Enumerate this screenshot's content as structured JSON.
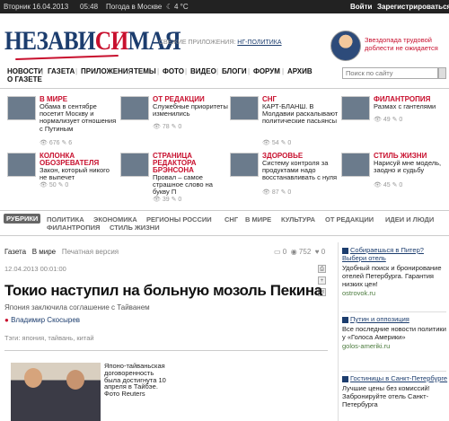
{
  "topbar": {
    "date": "Вторник 16.04.2013",
    "time": "05:48",
    "weather": "Погода в Москве",
    "temp": "4 °C",
    "login": "Войти",
    "register": "Зарегистрироваться"
  },
  "brand": {
    "logo_blue_1": "НЕЗАВИ",
    "logo_red": "СИ",
    "logo_blue_2": "МАЯ"
  },
  "fresh": {
    "label": "СВЕЖИЕ ПРИЛОЖЕНИЯ:",
    "link": "НГ-ПОЛИТИКА"
  },
  "promo": {
    "text": "Звездопада трудовой доблести не ожидается"
  },
  "nav": {
    "items": [
      "НОВОСТИ",
      "ГАЗЕТА",
      "ПРИЛОЖЕНИЯ",
      "ТЕМЫ",
      "ФОТО",
      "ВИДЕО",
      "БЛОГИ",
      "ФОРУМ",
      "АРХИВ"
    ],
    "line2": "О ГАЗЕТЕ",
    "separator": "|",
    "search_placeholder": "Поиск по сайту"
  },
  "tiles": [
    {
      "category": "В МИРЕ",
      "title": "Обама в сентябре посетит Москву и нормализует отношения с Путиным",
      "views": "676",
      "comments": "6"
    },
    {
      "category": "ОТ РЕДАКЦИИ",
      "title": "Служебные приоритеты изменились",
      "views": "78",
      "comments": "0"
    },
    {
      "category": "СНГ",
      "title": "КАРТ-БЛАНШ. В Молдавии раскалывают политические пасьянсы",
      "views": "54",
      "comments": "0"
    },
    {
      "category": "ФИЛАНТРОПИЯ",
      "title": "Размах с гантелями",
      "views": "49",
      "comments": "0"
    },
    {
      "category": "КОЛОНКА ОБОЗРЕВАТЕЛЯ",
      "title": "Закон, который никого не выпечет",
      "views": "50",
      "comments": "0"
    },
    {
      "category": "СТРАНИЦА РЕДАКТОРА БРЭНСОНА",
      "title": "Провал – самое страшное слово на букву П",
      "views": "39",
      "comments": "0"
    },
    {
      "category": "ЗДОРОВЬЕ",
      "title": "Систему контроля за продуктами надо восстанавливать с нуля",
      "views": "87",
      "comments": "0"
    },
    {
      "category": "СТИЛЬ ЖИЗНИ",
      "title": "Нарисуй мне модель, заодно и судьбу",
      "views": "45",
      "comments": "0"
    }
  ],
  "rubrics": {
    "button": "РУБРИКИ",
    "row1": [
      "ПОЛИТИКА",
      "ЭКОНОМИКА",
      "РЕГИОНЫ РОССИИ",
      "СНГ",
      "В МИРЕ",
      "КУЛЬТУРА",
      "ОТ РЕДАКЦИИ",
      "ИДЕИ И ЛЮДИ"
    ],
    "row2": [
      "ФИЛАНТРОПИЯ",
      "СТИЛЬ ЖИЗНИ"
    ]
  },
  "article": {
    "crumb_paper": "Газета",
    "crumb_section": "В мире",
    "crumb_print": "Печатная версия",
    "comments": "0",
    "views": "752",
    "likes": "0",
    "date": "12.04.2013 00:01:00",
    "headline": "Токио наступил на больную мозоль Пекина",
    "subhead": "Япония заключила соглашение с Тайванем",
    "author": "Владимир Скосырев",
    "tags_label": "Тэги:",
    "tags": "япония, тайвань, китай",
    "caption": "Японо-тайваньская договоренность была достигнута 10 апреля в Тайбэе. Фото Reuters",
    "tools": [
      "print",
      "plus",
      "mail"
    ]
  },
  "sidebar": {
    "ads": [
      {
        "title": "Собираешься в Питер? Выбери отель",
        "body": "Удобный поиск и бронирование отелей Петербурга. Гарантия низких цен!",
        "url": "ostrovok.ru"
      },
      {
        "title": "Путин и оппозиция",
        "body": "Все последние новости политики у «Голоса Америки»",
        "url": "golos-ameriki.ru"
      },
      {
        "title": "Гостиницы в Санкт-Петербурге",
        "body": "Лучшие цены без комиссий! Забронируйте отель Санкт-Петербурга",
        "url": ""
      }
    ]
  }
}
